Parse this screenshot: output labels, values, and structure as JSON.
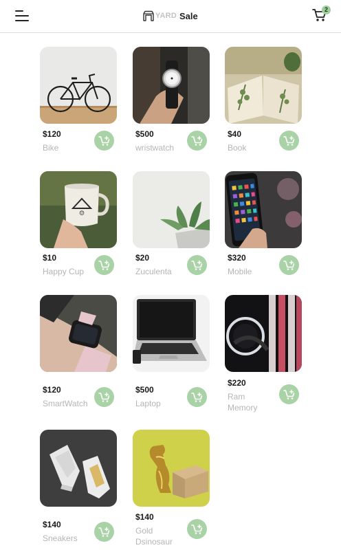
{
  "header": {
    "brand_yard": "YARD",
    "brand_sale": "Sale",
    "cart_count": "2",
    "menu_icon": "hamburger-menu-icon",
    "cart_icon": "shopping-cart-icon"
  },
  "colors": {
    "accent_green": "#a9d3a7",
    "badge_green": "#9fcf9c",
    "muted_text": "#b5b5b5"
  },
  "products": [
    {
      "price": "$120",
      "name": "Bike"
    },
    {
      "price": "$500",
      "name": "wristwatch"
    },
    {
      "price": "$40",
      "name": "Book"
    },
    {
      "price": "$10",
      "name": "Happy Cup"
    },
    {
      "price": "$20",
      "name": "Zuculenta"
    },
    {
      "price": "$320",
      "name": "Mobile"
    },
    {
      "price": "$120",
      "name": "SmartWatch"
    },
    {
      "price": "$500",
      "name": "Laptop"
    },
    {
      "price": "$220",
      "name": "Ram Memory"
    },
    {
      "price": "$140",
      "name": "Sneakers"
    },
    {
      "price": "$140",
      "name": "Gold Dsinosaur"
    }
  ]
}
